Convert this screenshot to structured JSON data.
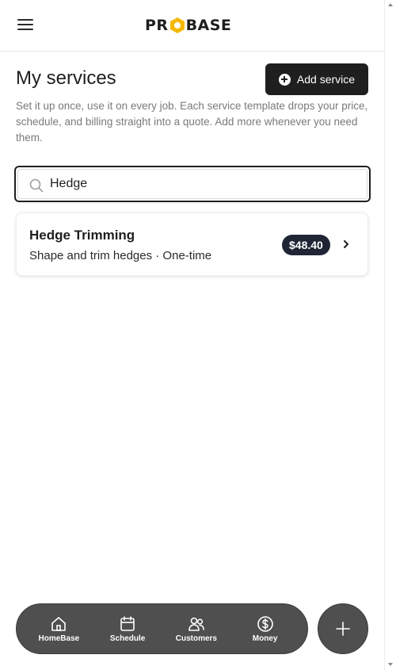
{
  "topbar": {
    "menu_icon": "hamburger-menu-icon",
    "logo_text_left": "PR",
    "logo_text_right": "BASE",
    "logo_accent_color": "#f5b800"
  },
  "header": {
    "title": "My services",
    "add_button_label": "Add service",
    "add_button_icon": "plus-circle-icon"
  },
  "description": "Set it up once, use it on every job. Each service template drops your price, schedule, and billing straight into a quote. Add more whenever you need them.",
  "search": {
    "value": "Hedge",
    "icon": "search-icon"
  },
  "services": [
    {
      "name": "Hedge Trimming",
      "meta": "Shape and trim hedges · One-time",
      "price": "$48.40"
    }
  ],
  "bottom_nav": {
    "items": [
      {
        "label": "HomeBase",
        "icon": "home-icon"
      },
      {
        "label": "Schedule",
        "icon": "calendar-icon"
      },
      {
        "label": "Customers",
        "icon": "customers-icon"
      },
      {
        "label": "Money",
        "icon": "dollar-icon"
      }
    ],
    "fab_icon": "plus-icon"
  },
  "colors": {
    "primary_dark": "#1f1f1f",
    "nav_bg": "#4f4f4f",
    "badge_bg": "#1f2535",
    "muted_text": "#7a7a7a"
  }
}
